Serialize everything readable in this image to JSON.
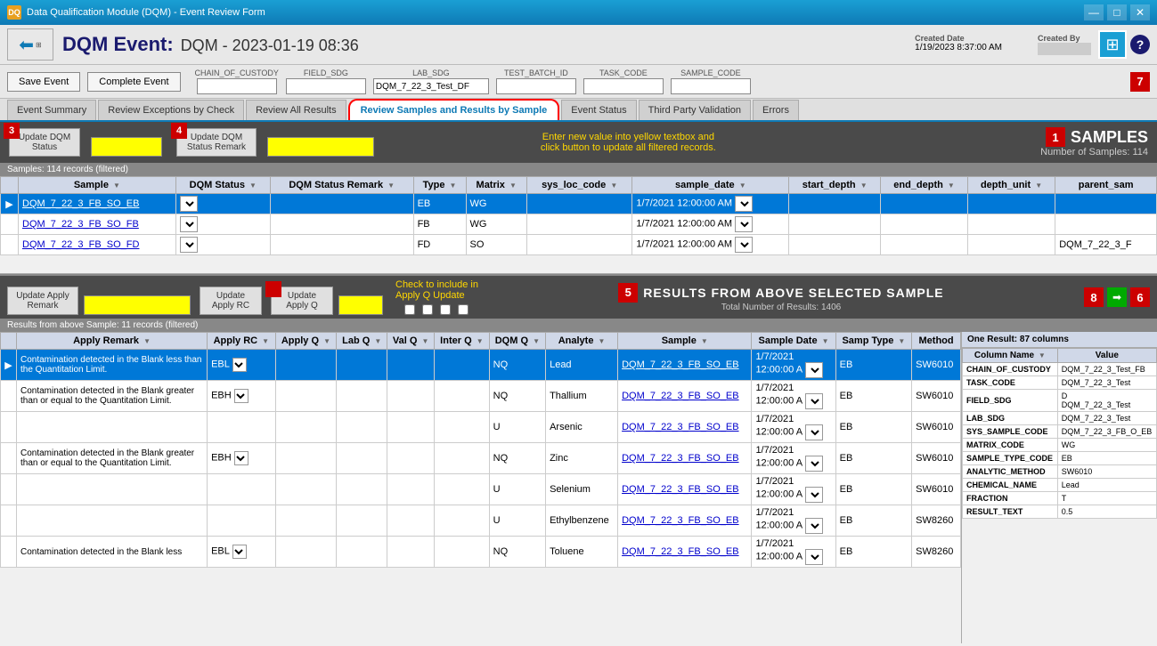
{
  "titleBar": {
    "title": "Data Qualification Module (DQM) - Event Review Form",
    "minimize": "—",
    "maximize": "□",
    "close": "✕"
  },
  "header": {
    "dqmLabel": "DQM Event:",
    "eventId": "DQM - 2023-01-19 08:36",
    "createdDateLabel": "Created Date",
    "createdDateValue": "1/19/2023 8:37:00 AM",
    "createdByLabel": "Created By",
    "createdByValue": "████████"
  },
  "toolbar": {
    "saveEvent": "Save Event",
    "completeEvent": "Complete Event",
    "fields": [
      {
        "label": "CHAIN_OF_CUSTODY",
        "value": ""
      },
      {
        "label": "FIELD_SDG",
        "value": ""
      },
      {
        "label": "LAB_SDG",
        "value": "DQM_7_22_3_Test_DF"
      },
      {
        "label": "TEST_BATCH_ID",
        "value": ""
      },
      {
        "label": "TASK_CODE",
        "value": ""
      },
      {
        "label": "SAMPLE_CODE",
        "value": ""
      }
    ],
    "badge7": "7"
  },
  "tabs": [
    {
      "id": "event-summary",
      "label": "Event Summary",
      "active": false
    },
    {
      "id": "review-exceptions",
      "label": "Review Exceptions by Check",
      "active": false
    },
    {
      "id": "review-all-results",
      "label": "Review All Results",
      "active": false
    },
    {
      "id": "review-samples",
      "label": "Review Samples and Results by Sample",
      "active": true,
      "highlighted": true
    },
    {
      "id": "event-status",
      "label": "Event Status",
      "active": false
    },
    {
      "id": "third-party",
      "label": "Third Party Validation",
      "active": false
    },
    {
      "id": "errors",
      "label": "Errors",
      "active": false
    }
  ],
  "samplesSection": {
    "badge": "1",
    "title": "SAMPLES",
    "subtitle": "Number of Samples: 114",
    "updateDQMStatusBtn": "Update DQM\nStatus",
    "updateDQMStatusRemarkBtn": "Update DQM\nStatus Remark",
    "badge3": "3",
    "badge4": "4",
    "infoText": "Enter new value into yellow textbox and click button to update all filtered records.",
    "recordsBar": "Samples: 114 records (filtered)",
    "columns": [
      "Sample",
      "DQM Status",
      "DQM Status Remark",
      "Type",
      "Matrix",
      "sys_loc_code",
      "sample_date",
      "start_depth",
      "end_depth",
      "depth_unit",
      "parent_sam"
    ],
    "rows": [
      {
        "sample": "DQM_7_22_3_FB_SO_EB",
        "dqmStatus": "",
        "dqmStatusRemark": "",
        "type": "EB",
        "matrix": "WG",
        "sysLocCode": "",
        "sampleDate": "1/7/2021 12:00:00 AM",
        "startDepth": "",
        "endDepth": "",
        "depthUnit": "",
        "parentSam": "",
        "selected": true
      },
      {
        "sample": "DQM_7_22_3_FB_SO_FB",
        "dqmStatus": "",
        "dqmStatusRemark": "",
        "type": "FB",
        "matrix": "WG",
        "sysLocCode": "",
        "sampleDate": "1/7/2021 12:00:00 AM",
        "startDepth": "",
        "endDepth": "",
        "depthUnit": "",
        "parentSam": "",
        "selected": false
      },
      {
        "sample": "DQM_7_22_3_FB_SO_FD",
        "dqmStatus": "",
        "dqmStatusRemark": "",
        "type": "FD",
        "matrix": "SO",
        "sysLocCode": "",
        "sampleDate": "1/7/2021 12:00:00 AM",
        "startDepth": "",
        "endDepth": "",
        "depthUnit": "",
        "parentSam": "DQM_7_22_3_F",
        "selected": false
      }
    ]
  },
  "resultsSection": {
    "badge5": "5",
    "title": "Results from Above Selected Sample",
    "subtitle": "Total Number of Results: 1406",
    "updateApplyRemarkBtn": "Update Apply\nRemark",
    "updateApplyRCBtn": "Update\nApply RC",
    "updateApplyQBtn": "Update\nApply Q",
    "badge8": "8",
    "badge6": "6",
    "checkIncludeText": "Check to include in\nApply Q Update",
    "recordsBar": "Results from above Sample: 11 records (filtered)",
    "rightPanelHeader": "One Result: 87 columns",
    "columns": [
      "Apply Remark",
      "Apply RC",
      "Apply Q",
      "Lab Q",
      "Val Q",
      "Inter Q",
      "DQM Q",
      "Analyte",
      "Sample",
      "Sample Date",
      "Samp Type",
      "Method"
    ],
    "rightPanelColumns": [
      "Column Name",
      "Value"
    ],
    "rightPanelRows": [
      {
        "col": "CHAIN_OF_CUSTODY",
        "val": "DQM_7_22_3_Test_FB"
      },
      {
        "col": "TASK_CODE",
        "val": "DQM_7_22_3_Test"
      },
      {
        "col": "FIELD_SDG",
        "val": "D\nDQM_7_22_3_Test"
      },
      {
        "col": "LAB_SDG",
        "val": "DQM_7_22_3_Test"
      },
      {
        "col": "SYS_SAMPLE_CODE",
        "val": "DQM_7_22_3_FB_O_EB"
      },
      {
        "col": "MATRIX_CODE",
        "val": "WG"
      },
      {
        "col": "SAMPLE_TYPE_CODE",
        "val": "EB"
      },
      {
        "col": "ANALYTIC_METHOD",
        "val": "SW6010"
      },
      {
        "col": "CHEMICAL_NAME",
        "val": "Lead"
      },
      {
        "col": "FRACTION",
        "val": "T"
      },
      {
        "col": "RESULT_TEXT",
        "val": "0.5"
      }
    ],
    "rows": [
      {
        "applyRemark": "Contamination detected in the Blank less than the Quantitation Limit.",
        "applyRC": "EBL",
        "applyQ": "",
        "labQ": "",
        "valQ": "",
        "interQ": "",
        "dqmQ": "NQ",
        "analyte": "Lead",
        "sample": "DQM_7_22_3_FB_SO_EB",
        "sampleDate": "1/7/2021\n12:00:00 A",
        "sampType": "EB",
        "method": "SW6010",
        "selected": true
      },
      {
        "applyRemark": "Contamination detected in the Blank greater than or equal to the Quantitation Limit.",
        "applyRC": "EBH",
        "applyQ": "",
        "labQ": "",
        "valQ": "",
        "interQ": "",
        "dqmQ": "NQ",
        "analyte": "Thallium",
        "sample": "DQM_7_22_3_FB_SO_EB",
        "sampleDate": "1/7/2021\n12:00:00 A",
        "sampType": "EB",
        "method": "SW6010",
        "selected": false
      },
      {
        "applyRemark": "",
        "applyRC": "",
        "applyQ": "",
        "labQ": "",
        "valQ": "",
        "interQ": "",
        "dqmQ": "U",
        "analyte": "Arsenic",
        "sample": "DQM_7_22_3_FB_SO_EB",
        "sampleDate": "1/7/2021\n12:00:00 A",
        "sampType": "EB",
        "method": "SW6010",
        "selected": false
      },
      {
        "applyRemark": "Contamination detected in the Blank greater than or equal to the Quantitation Limit.",
        "applyRC": "EBH",
        "applyQ": "",
        "labQ": "",
        "valQ": "",
        "interQ": "",
        "dqmQ": "NQ",
        "analyte": "Zinc",
        "sample": "DQM_7_22_3_FB_SO_EB",
        "sampleDate": "1/7/2021\n12:00:00 A",
        "sampType": "EB",
        "method": "SW6010",
        "selected": false
      },
      {
        "applyRemark": "",
        "applyRC": "",
        "applyQ": "",
        "labQ": "",
        "valQ": "",
        "interQ": "",
        "dqmQ": "U",
        "analyte": "Selenium",
        "sample": "DQM_7_22_3_FB_SO_EB",
        "sampleDate": "1/7/2021\n12:00:00 A",
        "sampType": "EB",
        "method": "SW6010",
        "selected": false
      },
      {
        "applyRemark": "",
        "applyRC": "",
        "applyQ": "",
        "labQ": "",
        "valQ": "",
        "interQ": "",
        "dqmQ": "U",
        "analyte": "Ethylbenzene",
        "sample": "DQM_7_22_3_FB_SO_EB",
        "sampleDate": "1/7/2021\n12:00:00 A",
        "sampType": "EB",
        "method": "SW8260",
        "selected": false
      },
      {
        "applyRemark": "Contamination detected in the Blank less",
        "applyRC": "EBL",
        "applyQ": "",
        "labQ": "",
        "valQ": "",
        "interQ": "",
        "dqmQ": "NQ",
        "analyte": "Toluene",
        "sample": "DQM_7_22_3_FB_SO_EB",
        "sampleDate": "1/7/2021\n12:00:00 A",
        "sampType": "EB",
        "method": "SW8260",
        "selected": false
      }
    ]
  }
}
